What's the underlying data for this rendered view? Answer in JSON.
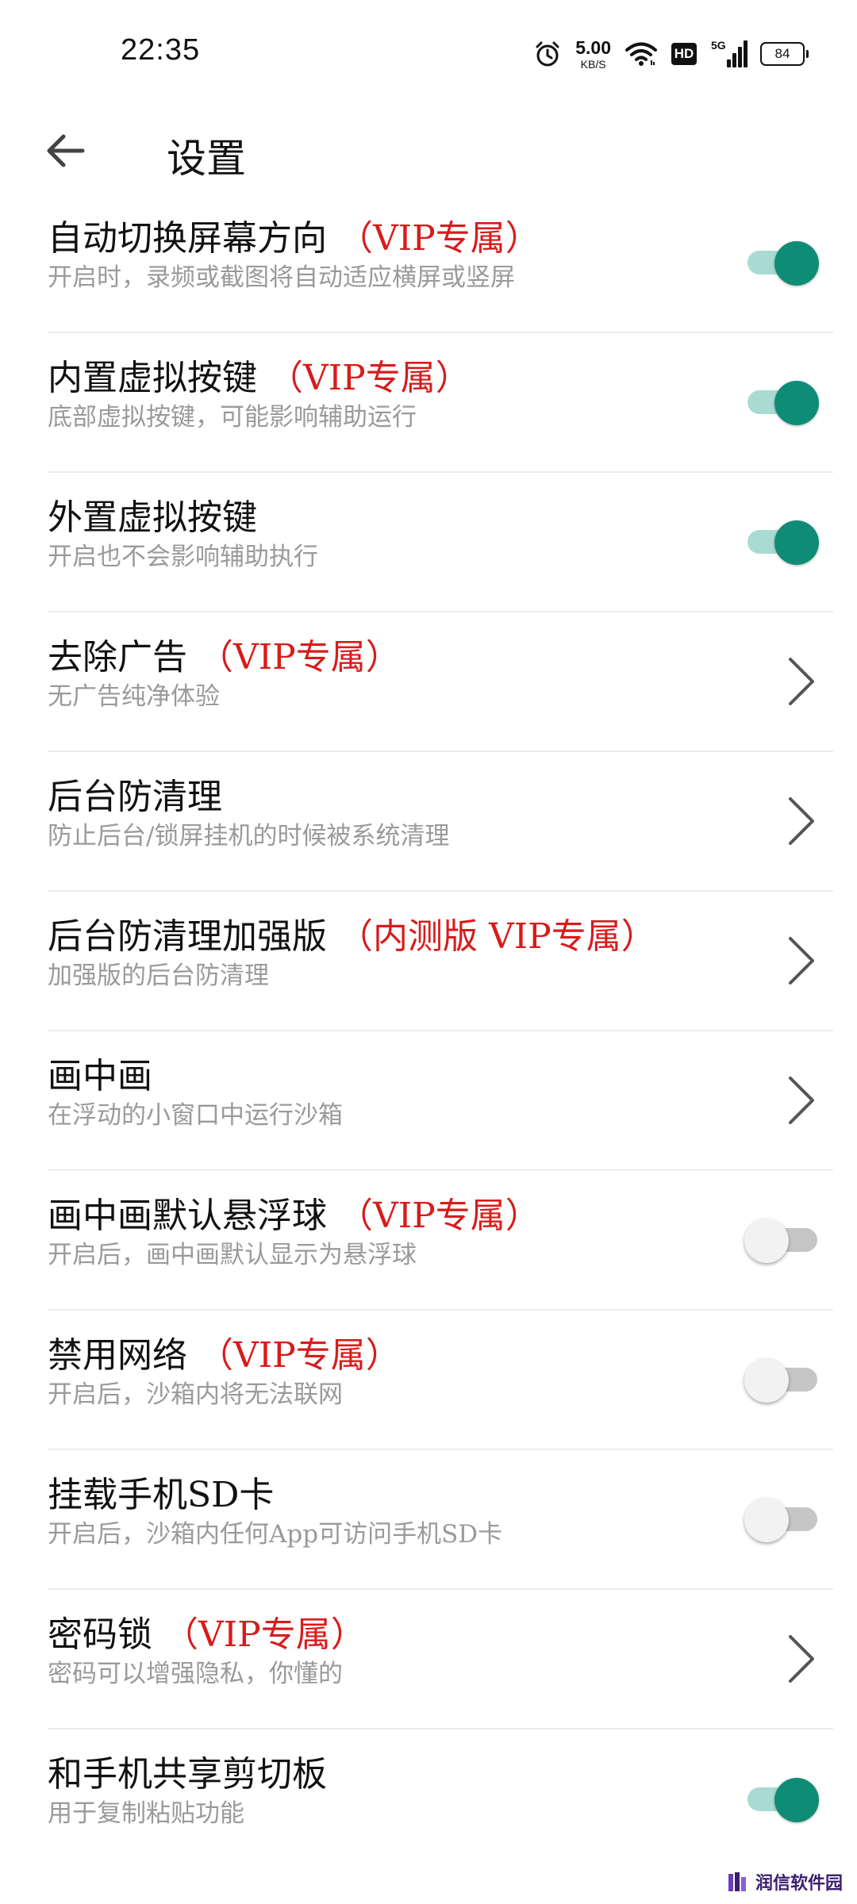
{
  "status_bar": {
    "time": "22:35",
    "net_speed_value": "5.00",
    "net_speed_unit": "KB/S",
    "hd_label": "HD",
    "signal_label": "5G",
    "battery": "84",
    "icons": [
      "alarm-icon",
      "wifi-icon",
      "hd-icon",
      "signal-icon",
      "battery-icon"
    ]
  },
  "header": {
    "back_icon": "arrow-left-icon",
    "title": "设置"
  },
  "settings": [
    {
      "title": "自动切换屏幕方向",
      "tag": "（VIP专属）",
      "subtitle": "开启时，录频或截图将自动适应横屏或竖屏",
      "control": "toggle",
      "state": "on"
    },
    {
      "title": "内置虚拟按键",
      "tag": "（VIP专属）",
      "subtitle": "底部虚拟按键，可能影响辅助运行",
      "control": "toggle",
      "state": "on"
    },
    {
      "title": "外置虚拟按键",
      "tag": "",
      "subtitle": "开启也不会影响辅助执行",
      "control": "toggle",
      "state": "on"
    },
    {
      "title": "去除广告",
      "tag": "（VIP专属）",
      "subtitle": "无广告纯净体验",
      "control": "chevron",
      "state": ""
    },
    {
      "title": "后台防清理",
      "tag": "",
      "subtitle": "防止后台/锁屏挂机的时候被系统清理",
      "control": "chevron",
      "state": ""
    },
    {
      "title": "后台防清理加强版",
      "tag": "（内测版 VIP专属）",
      "subtitle": "加强版的后台防清理",
      "control": "chevron",
      "state": ""
    },
    {
      "title": "画中画",
      "tag": "",
      "subtitle": "在浮动的小窗口中运行沙箱",
      "control": "chevron",
      "state": ""
    },
    {
      "title": "画中画默认悬浮球",
      "tag": "（VIP专属）",
      "subtitle": "开启后，画中画默认显示为悬浮球",
      "control": "toggle",
      "state": "off"
    },
    {
      "title": "禁用网络",
      "tag": "（VIP专属）",
      "subtitle": "开启后，沙箱内将无法联网",
      "control": "toggle",
      "state": "off"
    },
    {
      "title": "挂载手机SD卡",
      "tag": "",
      "subtitle": "开启后，沙箱内任何App可访问手机SD卡",
      "control": "toggle",
      "state": "off"
    },
    {
      "title": "密码锁",
      "tag": "（VIP专属）",
      "subtitle": "密码可以增强隐私，你懂的",
      "control": "chevron",
      "state": ""
    },
    {
      "title": "和手机共享剪切板",
      "tag": "",
      "subtitle": "用于复制粘贴功能",
      "control": "toggle",
      "state": "on"
    }
  ],
  "watermark": {
    "text": "润信软件园"
  },
  "colors": {
    "accent": "#0f8c76",
    "accent_track": "#a9dbd2",
    "vip_red": "#d81b1b",
    "subtitle_gray": "#9a9a9a",
    "divider": "#ececec"
  }
}
